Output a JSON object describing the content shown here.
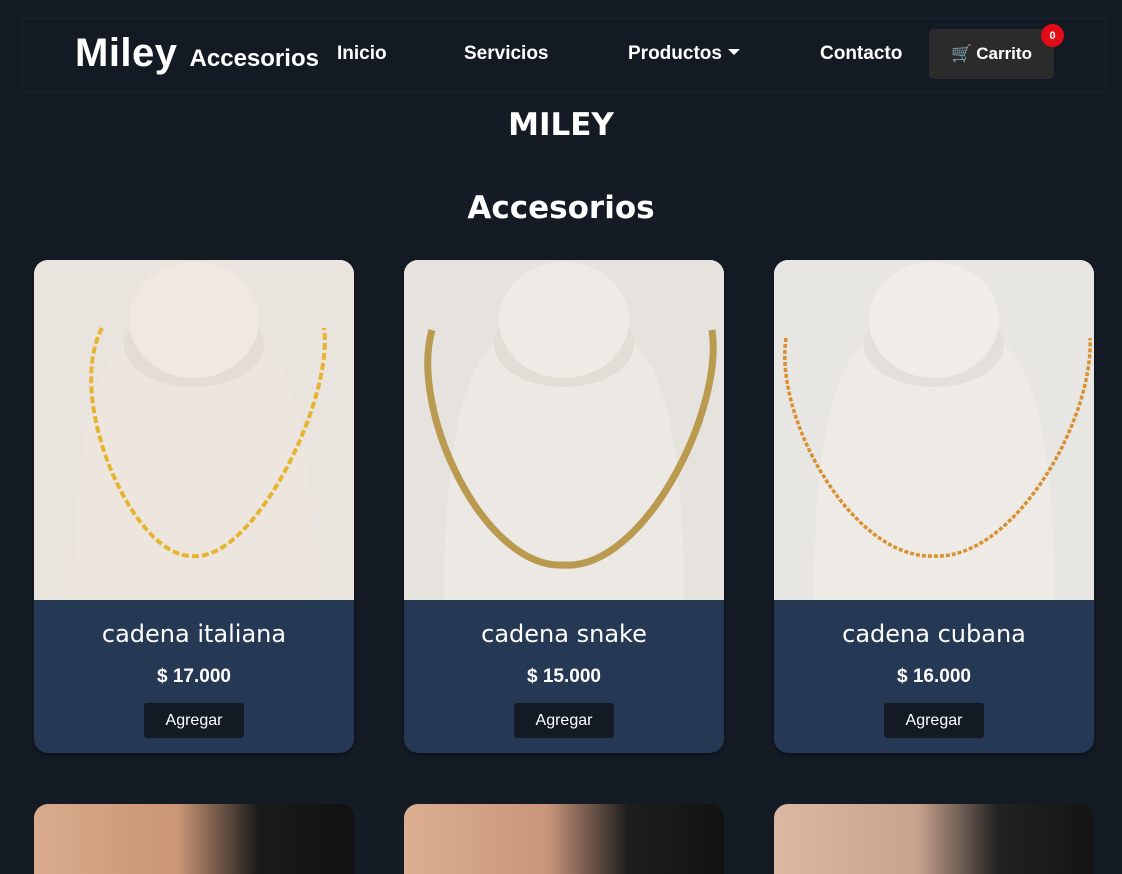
{
  "navbar": {
    "brand_main": "Miley",
    "brand_sub": "Accesorios",
    "links": [
      {
        "label": "Inicio"
      },
      {
        "label": "Servicios"
      },
      {
        "label": "Productos"
      },
      {
        "label": "Contacto"
      }
    ],
    "cart": {
      "label": "Carrito",
      "count": "0",
      "icon": "cart-icon"
    }
  },
  "titles": {
    "main": "MILEY",
    "section": "Accesorios"
  },
  "products": [
    {
      "name": "cadena italiana",
      "price": "$ 17.000",
      "button": "Agregar",
      "chain_color": "#e7b331"
    },
    {
      "name": "cadena snake",
      "price": "$ 15.000",
      "button": "Agregar",
      "chain_color": "#b99a4e"
    },
    {
      "name": "cadena cubana",
      "price": "$ 16.000",
      "button": "Agregar",
      "chain_color": "#d9902f"
    }
  ],
  "colors": {
    "background": "#151b25",
    "card_body": "#253854",
    "badge": "#e40b18",
    "cart_button": "#2b2b2c"
  }
}
